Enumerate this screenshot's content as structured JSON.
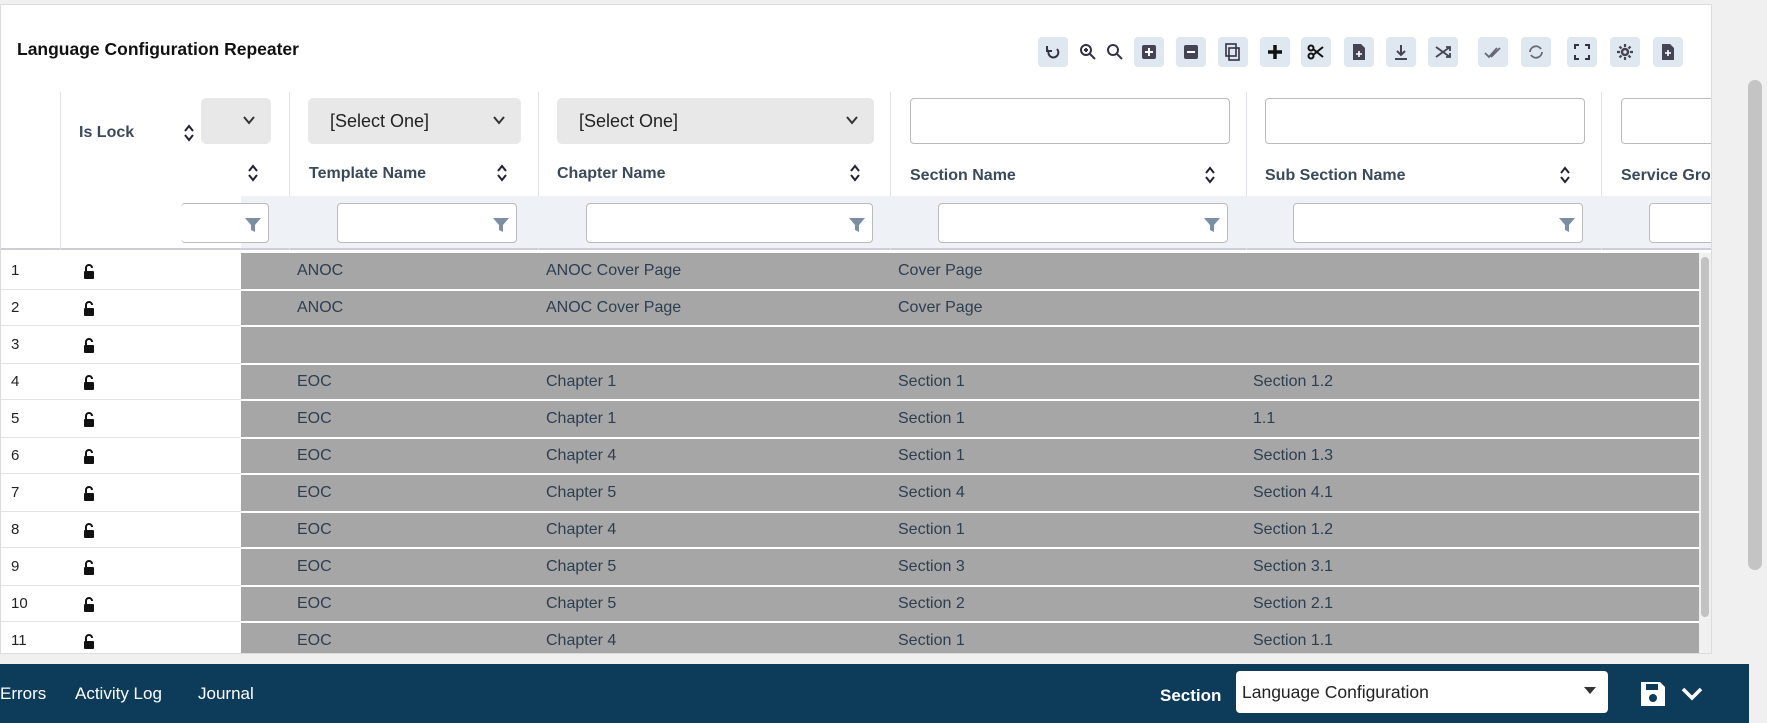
{
  "panel": {
    "title": "Language Configuration Repeater"
  },
  "toolbar": {
    "icons": [
      "undo-icon",
      "zoom-in-icon",
      "search-icon",
      "add-box-icon",
      "remove-box-icon",
      "copy-icon",
      "plus-icon",
      "cut-icon",
      "export-file-icon",
      "download-icon",
      "shuffle-icon",
      "check-all-icon",
      "refresh-icon",
      "fullscreen-icon",
      "settings-icon",
      "document-icon"
    ]
  },
  "grid": {
    "is_lock_header": "Is Lock",
    "columns": {
      "template": {
        "label": "Template Name",
        "filter_select": "[Select One]"
      },
      "chapter": {
        "label": "Chapter Name",
        "filter_select": "[Select One]"
      },
      "section": {
        "label": "Section Name"
      },
      "subsection": {
        "label": "Sub Section Name"
      },
      "service": {
        "label": "Service Gro"
      }
    },
    "rows": [
      {
        "num": "1",
        "template": "ANOC",
        "chapter": "ANOC Cover Page",
        "section": "Cover Page",
        "subsection": ""
      },
      {
        "num": "2",
        "template": "ANOC",
        "chapter": "ANOC Cover Page",
        "section": "Cover Page",
        "subsection": ""
      },
      {
        "num": "3",
        "template": "",
        "chapter": "",
        "section": "",
        "subsection": ""
      },
      {
        "num": "4",
        "template": "EOC",
        "chapter": "Chapter 1",
        "section": "Section 1",
        "subsection": "Section 1.2"
      },
      {
        "num": "5",
        "template": "EOC",
        "chapter": "Chapter 1",
        "section": "Section 1",
        "subsection": "1.1"
      },
      {
        "num": "6",
        "template": "EOC",
        "chapter": "Chapter 4",
        "section": "Section 1",
        "subsection": "Section 1.3"
      },
      {
        "num": "7",
        "template": "EOC",
        "chapter": "Chapter 5",
        "section": "Section 4",
        "subsection": "Section 4.1"
      },
      {
        "num": "8",
        "template": "EOC",
        "chapter": "Chapter 4",
        "section": "Section 1",
        "subsection": "Section 1.2"
      },
      {
        "num": "9",
        "template": "EOC",
        "chapter": "Chapter 5",
        "section": "Section 3",
        "subsection": "Section 3.1"
      },
      {
        "num": "10",
        "template": "EOC",
        "chapter": "Chapter 5",
        "section": "Section 2",
        "subsection": "Section 2.1"
      },
      {
        "num": "11",
        "template": "EOC",
        "chapter": "Chapter 4",
        "section": "Section 1",
        "subsection": "Section 1.1"
      }
    ]
  },
  "footer": {
    "tabs": [
      "Errors",
      "Activity Log",
      "Journal"
    ],
    "section_label": "Section",
    "section_value": "Language Configuration"
  }
}
